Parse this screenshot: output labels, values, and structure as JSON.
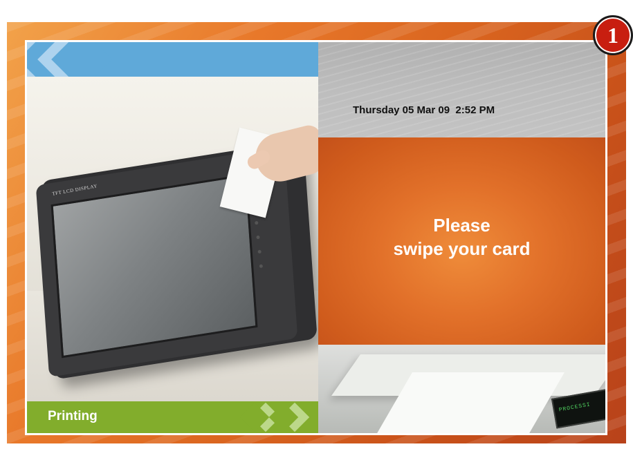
{
  "badge": {
    "number": "1",
    "color": "#c81e10"
  },
  "left_panel": {
    "device_label": "TFT LCD DISPLAY",
    "bottom_label": "Printing",
    "band_colors": {
      "top": "#5fa9d9",
      "bottom": "#82ad2c"
    }
  },
  "right_panel": {
    "datetime": "Thursday 05 Mar 09  2:52 PM",
    "prompt_line1": "Please",
    "prompt_line2": "swipe your card",
    "printer_display": "PROCESSI",
    "accent_color": "#e2712a"
  },
  "icons": [
    "double-chevron-left-icon",
    "double-chevron-right-icon"
  ]
}
